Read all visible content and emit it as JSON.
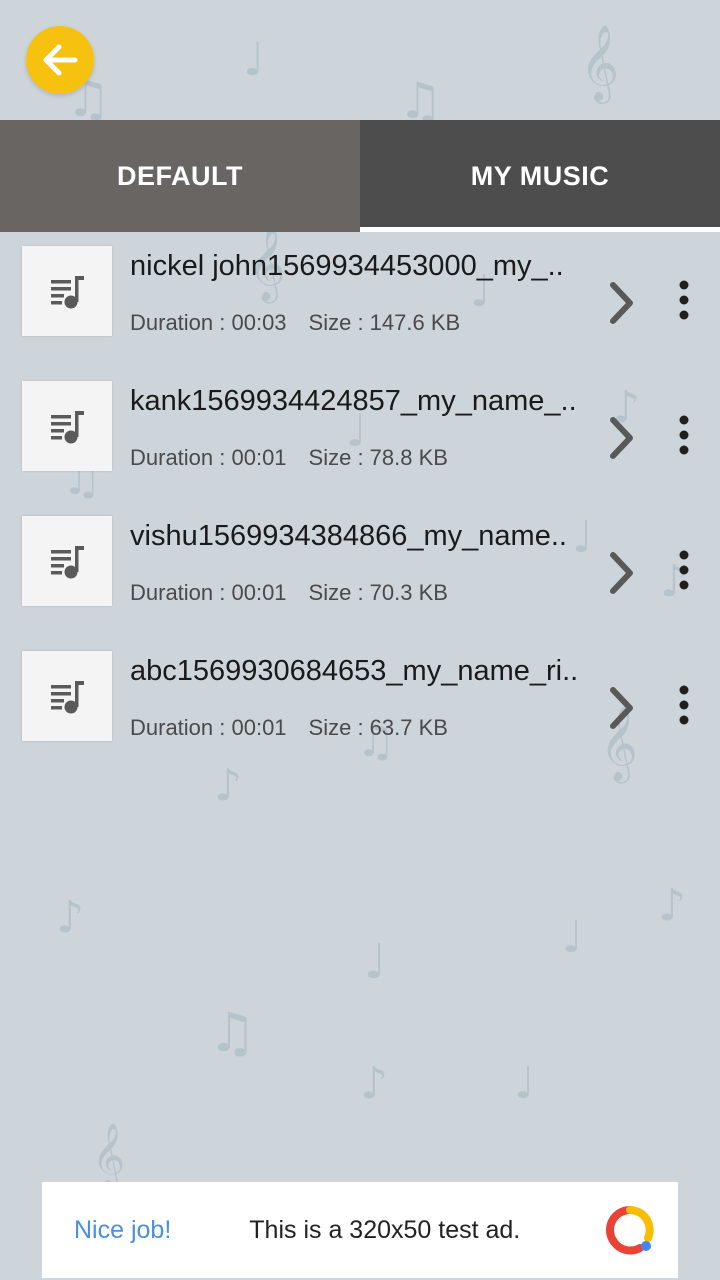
{
  "header": {
    "back_icon": "arrow-left-icon",
    "back_color": "#f6c20f"
  },
  "tabs": [
    {
      "label": "DEFAULT",
      "selected": false
    },
    {
      "label": "MY MUSIC",
      "selected": true
    }
  ],
  "songs": [
    {
      "title": "nickel john1569934453000_my_..",
      "duration": "Duration : 00:03",
      "size": "Size : 147.6 KB"
    },
    {
      "title": "kank1569934424857_my_name_..",
      "duration": "Duration : 00:01",
      "size": "Size : 78.8 KB"
    },
    {
      "title": "vishu1569934384866_my_name..",
      "duration": "Duration : 00:01",
      "size": "Size : 70.3 KB"
    },
    {
      "title": "abc1569930684653_my_name_ri..",
      "duration": "Duration : 00:01",
      "size": "Size : 63.7 KB"
    }
  ],
  "ad": {
    "nice_label": "Nice job!",
    "text": "This is a 320x50 test ad."
  },
  "colors": {
    "background": "#cdd5db",
    "tab_default": "#686563",
    "tab_selected": "#4d4d4d",
    "ad_accent": "#4a8fe0"
  }
}
